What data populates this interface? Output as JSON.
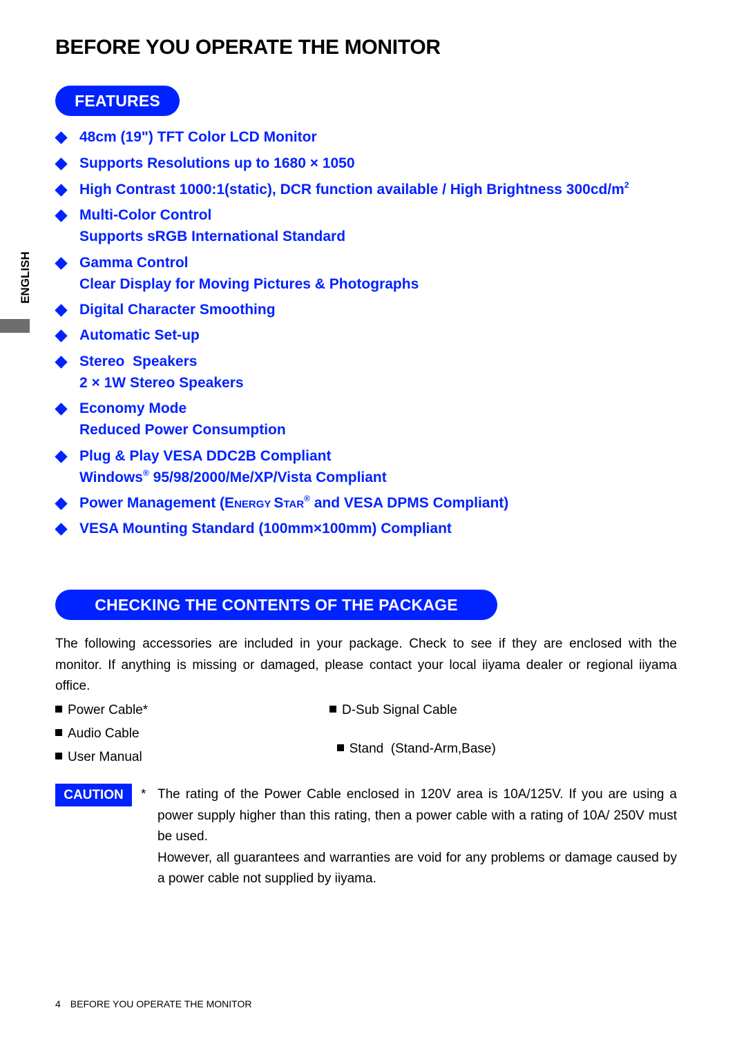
{
  "page_title": "BEFORE YOU OPERATE THE MONITOR",
  "side_tab": "ENGLISH",
  "features_section": {
    "heading": "FEATURES",
    "items": [
      {
        "text": "48cm (19\") TFT Color LCD Monitor"
      },
      {
        "text": "Supports Resolutions up to 1680 × 1050"
      },
      {
        "text_before_sup": "High Contrast 1000:1(static), DCR function available / High Brightness 300cd/m",
        "sup": "2"
      },
      {
        "text": "Multi-Color Control",
        "sub": "Supports sRGB International Standard"
      },
      {
        "text": "Gamma Control",
        "sub": "Clear Display for Moving Pictures & Photographs"
      },
      {
        "text": "Digital Character Smoothing"
      },
      {
        "text": "Automatic Set-up"
      },
      {
        "text": "Stereo  Speakers",
        "sub": "2 × 1W Stereo Speakers"
      },
      {
        "text": "Economy Mode",
        "sub": "Reduced Power Consumption"
      },
      {
        "text": "Plug & Play VESA DDC2B Compliant",
        "sub_prefix": "Windows",
        "sub_sup": "®",
        "sub_rest": " 95/98/2000/Me/XP/Vista Compliant"
      },
      {
        "prefix": "Power Management (",
        "e": "E",
        "nergy": "NERGY ",
        "s": "S",
        "tar": "TAR",
        "sup": "®",
        "suffix": " and VESA DPMS Compliant)"
      },
      {
        "text": "VESA Mounting Standard (100mm×100mm) Compliant"
      }
    ]
  },
  "package_section": {
    "heading": "CHECKING THE CONTENTS OF THE PACKAGE",
    "intro": "The following accessories are included in your package. Check to see if they are enclosed with the monitor. If anything is missing or damaged, please contact your local iiyama dealer or regional iiyama office.",
    "accessories": [
      "Power Cable*",
      "D-Sub Signal Cable",
      "Audio Cable",
      "Stand  (Stand-Arm,Base)",
      "User Manual"
    ],
    "caution": {
      "badge": "CAUTION",
      "marker": "*",
      "paragraph1": "The rating of the Power Cable enclosed in 120V area is 10A/125V. If you are using a power supply higher than this rating, then a power cable with a rating of 10A/ 250V must be used.",
      "paragraph2": "However, all guarantees and warranties are void for any problems or damage caused by a power cable not supplied by iiyama."
    }
  },
  "footer": {
    "page_number": "4",
    "title": "BEFORE YOU OPERATE THE MONITOR"
  },
  "colors": {
    "accent_blue": "#0022ff",
    "side_bar_gray": "#6e6e6e"
  }
}
